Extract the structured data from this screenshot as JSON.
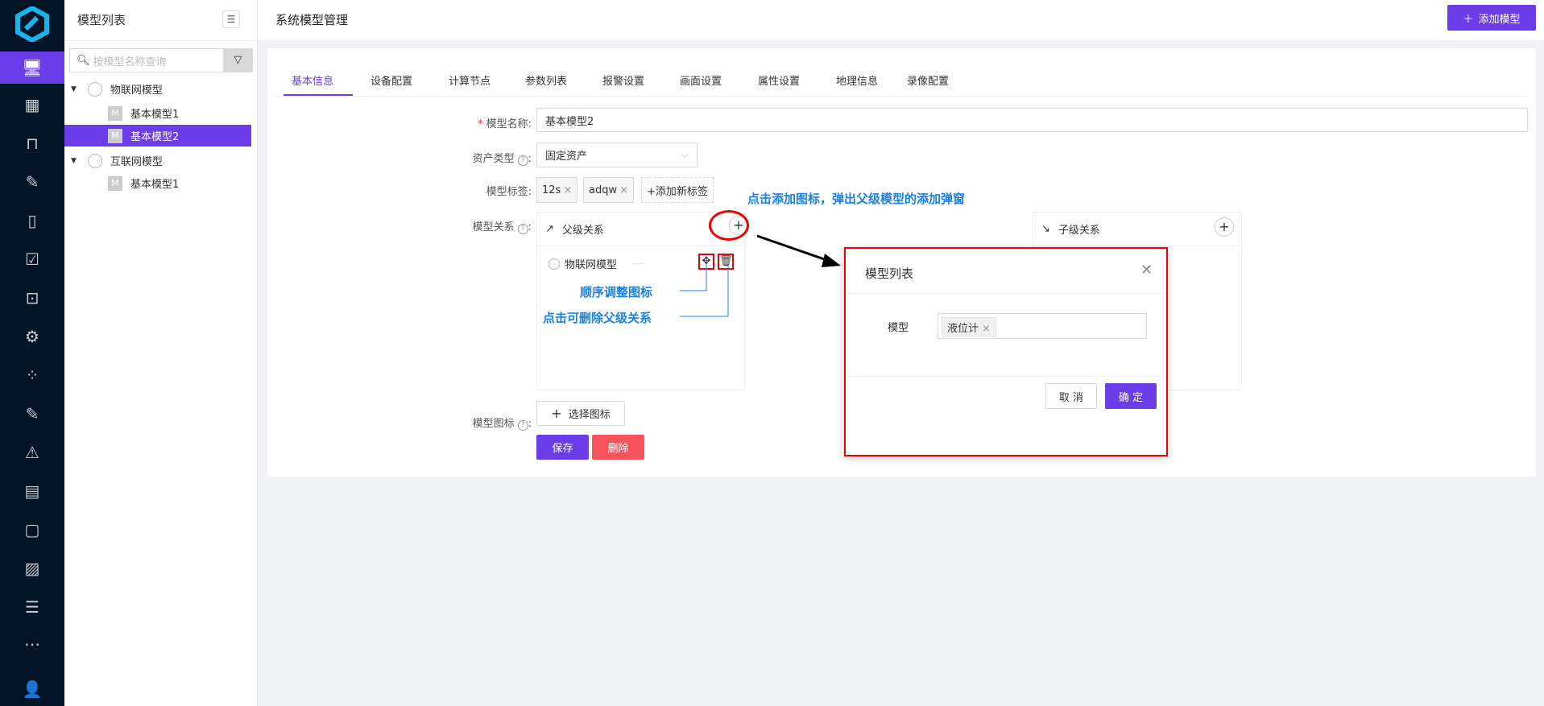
{
  "tree": {
    "title": "模型列表",
    "search_placeholder": "按模型名称查询",
    "nodes": [
      {
        "label": "物联网模型"
      },
      {
        "label": "基本模型1"
      },
      {
        "label": "基本模型2"
      },
      {
        "label": "互联网模型"
      },
      {
        "label": "基本模型1"
      }
    ],
    "m": "M"
  },
  "header": {
    "title": "系统模型管理",
    "add_button": "添加模型"
  },
  "tabs": [
    "基本信息",
    "设备配置",
    "计算节点",
    "参数列表",
    "报警设置",
    "画面设置",
    "属性设置",
    "地理信息",
    "录像配置"
  ],
  "form": {
    "name_label": "模型名称:",
    "name_value": "基本模型2",
    "asset_label": "资产类型",
    "asset_value": "固定资产",
    "tags_label": "模型标签:",
    "tags": [
      "12s",
      "adqw"
    ],
    "add_tag": "+添加新标签",
    "relation_label": "模型关系",
    "parent_title": "父级关系",
    "child_title": "子级关系",
    "parent_item": "物联网模型",
    "parent_item_dots": "-----",
    "icon_label": "模型图标",
    "choose_icon": "选择图标",
    "save": "保存",
    "delete": "删除",
    "colon": ":"
  },
  "annotations": {
    "add_hint": "点击添加图标，弹出父级模型的添加弹窗",
    "order_hint": "顺序调整图标",
    "delete_hint": "点击可删除父级关系"
  },
  "dialog": {
    "title": "模型列表",
    "field_label": "模型",
    "selected": "液位计",
    "cancel": "取 消",
    "ok": "确 定"
  },
  "colors": {
    "accent": "#6a3de8",
    "danger": "#f5545c",
    "annotation": "#1a7fe8"
  }
}
